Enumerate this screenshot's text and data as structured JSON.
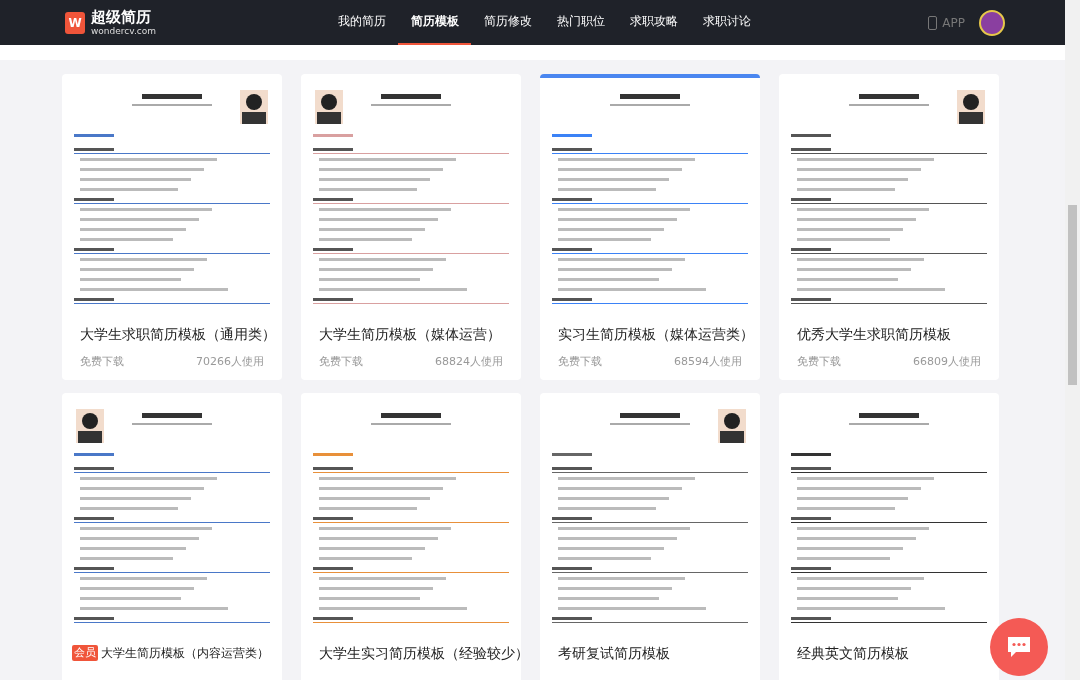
{
  "header": {
    "logo_title": "超级简历",
    "logo_subtitle": "wondercv.com",
    "logo_mark": "W",
    "nav": [
      {
        "label": "我的简历",
        "selected": false
      },
      {
        "label": "简历模板",
        "selected": true
      },
      {
        "label": "简历修改",
        "selected": false
      },
      {
        "label": "热门职位",
        "selected": false
      },
      {
        "label": "求职攻略",
        "selected": false
      },
      {
        "label": "求职讨论",
        "selected": false
      }
    ],
    "app_label": "APP"
  },
  "templates": [
    {
      "title": "大学生求职简历模板（通用类）",
      "price": "免费下载",
      "users": "70266人使用",
      "selected": false,
      "color": "#4a78c8",
      "has_photo": true,
      "photo_right": true
    },
    {
      "title": "大学生简历模板（媒体运营）",
      "price": "免费下载",
      "users": "68824人使用",
      "selected": false,
      "color": "#d9a0a0",
      "has_photo": true,
      "photo_right": false
    },
    {
      "title": "实习生简历模板（媒体运营类）",
      "price": "免费下载",
      "users": "68594人使用",
      "selected": true,
      "color": "#3b82f6",
      "has_photo": false
    },
    {
      "title": "优秀大学生求职简历模板",
      "price": "免费下载",
      "users": "66809人使用",
      "selected": false,
      "color": "#555555",
      "has_photo": true,
      "photo_right": true
    },
    {
      "title": "大学生简历模板（内容运营类）",
      "badge": "会员",
      "selected": false,
      "color": "#4a78c8",
      "has_photo": true,
      "photo_right": false
    },
    {
      "title": "大学生实习简历模板（经验较少）",
      "selected": false,
      "color": "#e8903a",
      "has_photo": false
    },
    {
      "title": "考研复试简历模板",
      "selected": false,
      "color": "#666666",
      "has_photo": true,
      "photo_right": true
    },
    {
      "title": "经典英文简历模板",
      "selected": false,
      "color": "#333333",
      "has_photo": false
    }
  ]
}
